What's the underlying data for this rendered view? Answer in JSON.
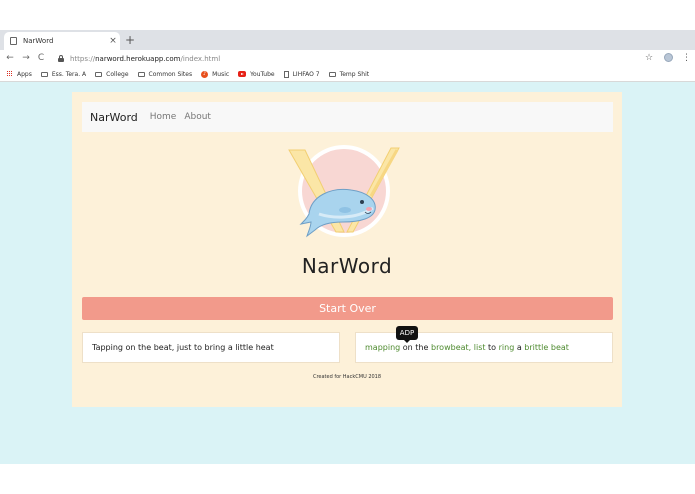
{
  "browser": {
    "tab": {
      "title": "NarWord",
      "close": "×"
    },
    "new_tab": "+",
    "nav": {
      "back": "←",
      "forward": "→",
      "reload": "C"
    },
    "address": {
      "scheme": "https://",
      "host": "narword.herokuapp.com",
      "path": "/index.html"
    },
    "star": "☆",
    "menu": "⋮",
    "bookmarks": [
      {
        "label": "Apps",
        "icon": "apps-icon"
      },
      {
        "label": "Ess. Tera. A",
        "icon": "folder-icon"
      },
      {
        "label": "College",
        "icon": "folder-icon"
      },
      {
        "label": "Common Sites",
        "icon": "folder-icon"
      },
      {
        "label": "Music",
        "icon": "music-icon"
      },
      {
        "label": "YouTube",
        "icon": "youtube-icon"
      },
      {
        "label": "LIHFAO 7",
        "icon": "document-icon"
      },
      {
        "label": "Temp Shit",
        "icon": "folder-icon"
      }
    ]
  },
  "page": {
    "navbar": {
      "brand": "NarWord",
      "links": [
        "Home",
        "About"
      ]
    },
    "logo": {
      "icon": "narwhal-logo",
      "letter": "V"
    },
    "title": "NarWord",
    "start_over": "Start Over",
    "original_line": "Tapping on the beat, just to bring a little heat",
    "generated_words": [
      {
        "text": "mapping",
        "highlight": true
      },
      {
        "text": "on",
        "highlight": false
      },
      {
        "text": "the",
        "highlight": false
      },
      {
        "text": "browbeat,",
        "highlight": true
      },
      {
        "text": "list",
        "highlight": true
      },
      {
        "text": "to",
        "highlight": false
      },
      {
        "text": "ring",
        "highlight": true
      },
      {
        "text": "a",
        "highlight": false
      },
      {
        "text": "brittle",
        "highlight": true
      },
      {
        "text": "beat",
        "highlight": true
      }
    ],
    "tooltip": "ADP",
    "footer": "Created for HackCMU 2018"
  },
  "colors": {
    "background": "#daf3f6",
    "card": "#fdf1d9",
    "start_over": "#f29a8b",
    "highlight_word": "#4d8a2e"
  }
}
